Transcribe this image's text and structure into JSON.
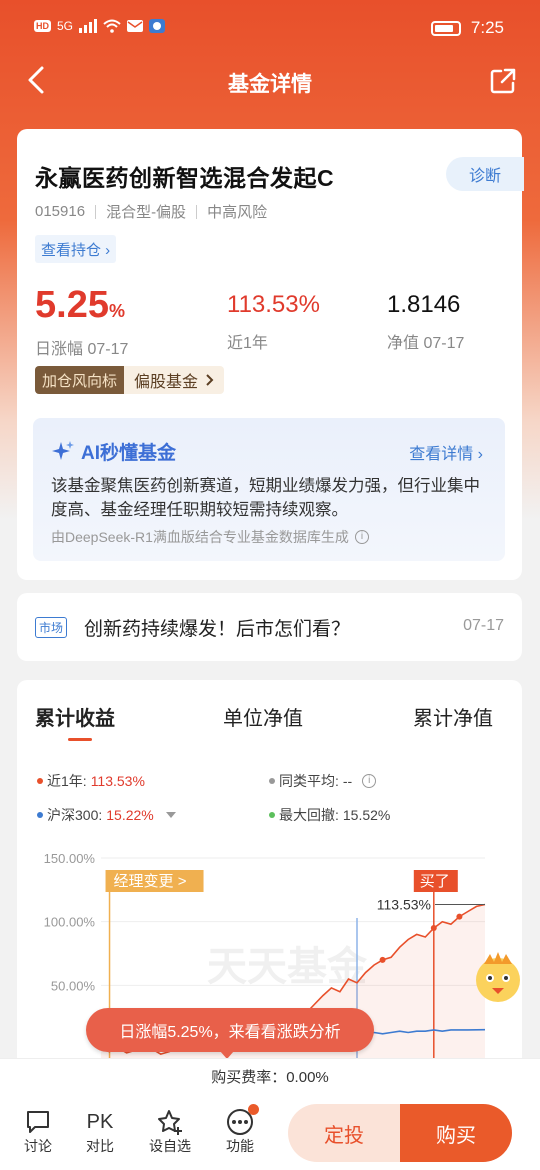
{
  "status_bar": {
    "left_icons": "HD",
    "signal": "5G",
    "time": "7:25"
  },
  "nav": {
    "title": "基金详情"
  },
  "fund": {
    "name": "永赢医药创新智选混合发起C",
    "diagnose_label": "诊断",
    "code": "015916",
    "type": "混合型-偏股",
    "risk": "中高风险",
    "holdings_label": "查看持仓 ›",
    "daily_change_value": "5.25",
    "daily_change_unit": "%",
    "daily_change_label": "日涨幅 07-17",
    "one_year_value": "113.53%",
    "one_year_label": "近1年",
    "nav_value": "1.8146",
    "nav_label": "净值 07-17",
    "tag_dark": "加仓风向标",
    "tag_light": "偏股基金"
  },
  "ai": {
    "title": "AI秒懂基金",
    "link": "查看详情 ›",
    "text": "该基金聚焦医药创新赛道，短期业绩爆发力强，但行业集中度高、基金经理任职期较短需持续观察。",
    "footer": "由DeepSeek-R1满血版结合专业基金数据库生成"
  },
  "news": {
    "tag": "市场",
    "title": "创新药持续爆发！后市怎们看？",
    "date": "07-17"
  },
  "chart": {
    "tabs": [
      "累计收益",
      "单位净值",
      "累计净值"
    ],
    "legend": {
      "fund_label": "近1年:",
      "fund_value": "113.53%",
      "avg_label": "同类平均:",
      "avg_value": "--",
      "index_label": "沪深300:",
      "index_value": "15.22%",
      "drawdown_label": "最大回撤:",
      "drawdown_value": "15.52%"
    },
    "manager_change_label": "经理变更 >",
    "bought_label": "买了",
    "end_label": "113.53%",
    "watermark": "天天基金"
  },
  "chart_data": {
    "type": "line",
    "yticks": [
      "150.00%",
      "100.00%",
      "50.00%"
    ],
    "ylim": [
      0,
      150
    ],
    "series": [
      {
        "name": "近1年",
        "color": "#e8502b",
        "values": [
          0,
          -2,
          1,
          -3,
          -1,
          2,
          0,
          -4,
          -2,
          1,
          3,
          0,
          2,
          5,
          8,
          6,
          10,
          14,
          12,
          18,
          22,
          20,
          26,
          30,
          28,
          35,
          42,
          48,
          45,
          55,
          52,
          60,
          66,
          70,
          72,
          80,
          86,
          90,
          88,
          95,
          100,
          98,
          104,
          108,
          112,
          113.53
        ]
      },
      {
        "name": "沪深300",
        "color": "#3d7bd1",
        "values": [
          0,
          -1,
          0,
          1,
          -1,
          0,
          2,
          1,
          0,
          2,
          3,
          2,
          4,
          3,
          5,
          4,
          6,
          5,
          7,
          6,
          8,
          7,
          9,
          8,
          10,
          9,
          10,
          11,
          10,
          12,
          11,
          12,
          13,
          12,
          13,
          14,
          13,
          14,
          14,
          15,
          14,
          15,
          15,
          15,
          15.1,
          15.22
        ]
      }
    ]
  },
  "bubble": {
    "text": "日涨幅5.25%，来看看涨跌分析"
  },
  "fee": {
    "text": "购买费率：0.00%"
  },
  "bottom": {
    "discuss": "讨论",
    "pk_icon": "PK",
    "compare": "对比",
    "watch": "设自选",
    "func": "功能",
    "dingtou": "定投",
    "buy": "购买"
  }
}
